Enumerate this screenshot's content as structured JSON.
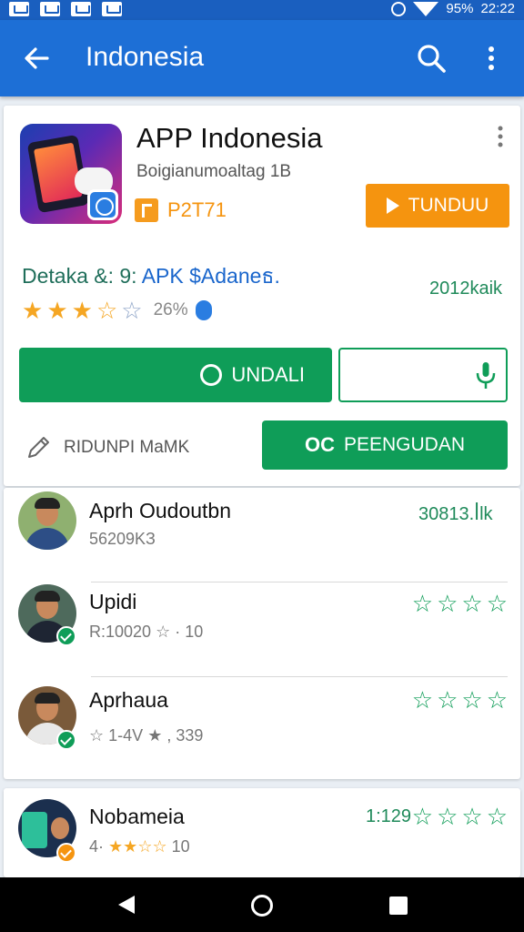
{
  "status_bar": {
    "battery": "95%",
    "time": "22:22"
  },
  "app_bar": {
    "title": "Indonesia"
  },
  "app_card": {
    "name": "APP Indonesia",
    "subtitle": "Boigianumoaltag 1B",
    "code": "P2T71",
    "install_label": "TUNDUU",
    "details_prefix": "Detaka &: 9:",
    "details_link": "APK $Adaneธ.",
    "download_count": "2012kaik",
    "rating": 3.5,
    "rating_max": 5,
    "rating_pct": "26%",
    "undali_label": "UNDALI",
    "edit_label": "RIDUNPI MaMK",
    "pengundan_label": "PEENGUDAN"
  },
  "reviews": [
    {
      "name": "Aprh Oudoutbn",
      "meta": "56209KЗ",
      "right_text": "30813.ꟾlk",
      "stars": 0
    },
    {
      "name": "Upidi",
      "meta_prefix": "R:10020",
      "meta_suffix": "· 10",
      "stars": 4
    },
    {
      "name": "Aprhaua",
      "meta_prefix": "1-4V",
      "meta_suffix": ", 339",
      "stars": 4
    },
    {
      "name": "Nobameia",
      "meta_prefix": "4·",
      "meta_suffix": "10",
      "right_text": "1:129",
      "stars": 4
    }
  ],
  "colors": {
    "app_bar": "#1d6fd6",
    "green": "#0f9d58",
    "orange": "#f5940f"
  },
  "icons": [
    "back-arrow-icon",
    "search-icon",
    "more-vert-icon",
    "play-icon",
    "chat-icon",
    "mic-icon",
    "pencil-icon",
    "shield-icon",
    "verified-icon"
  ]
}
